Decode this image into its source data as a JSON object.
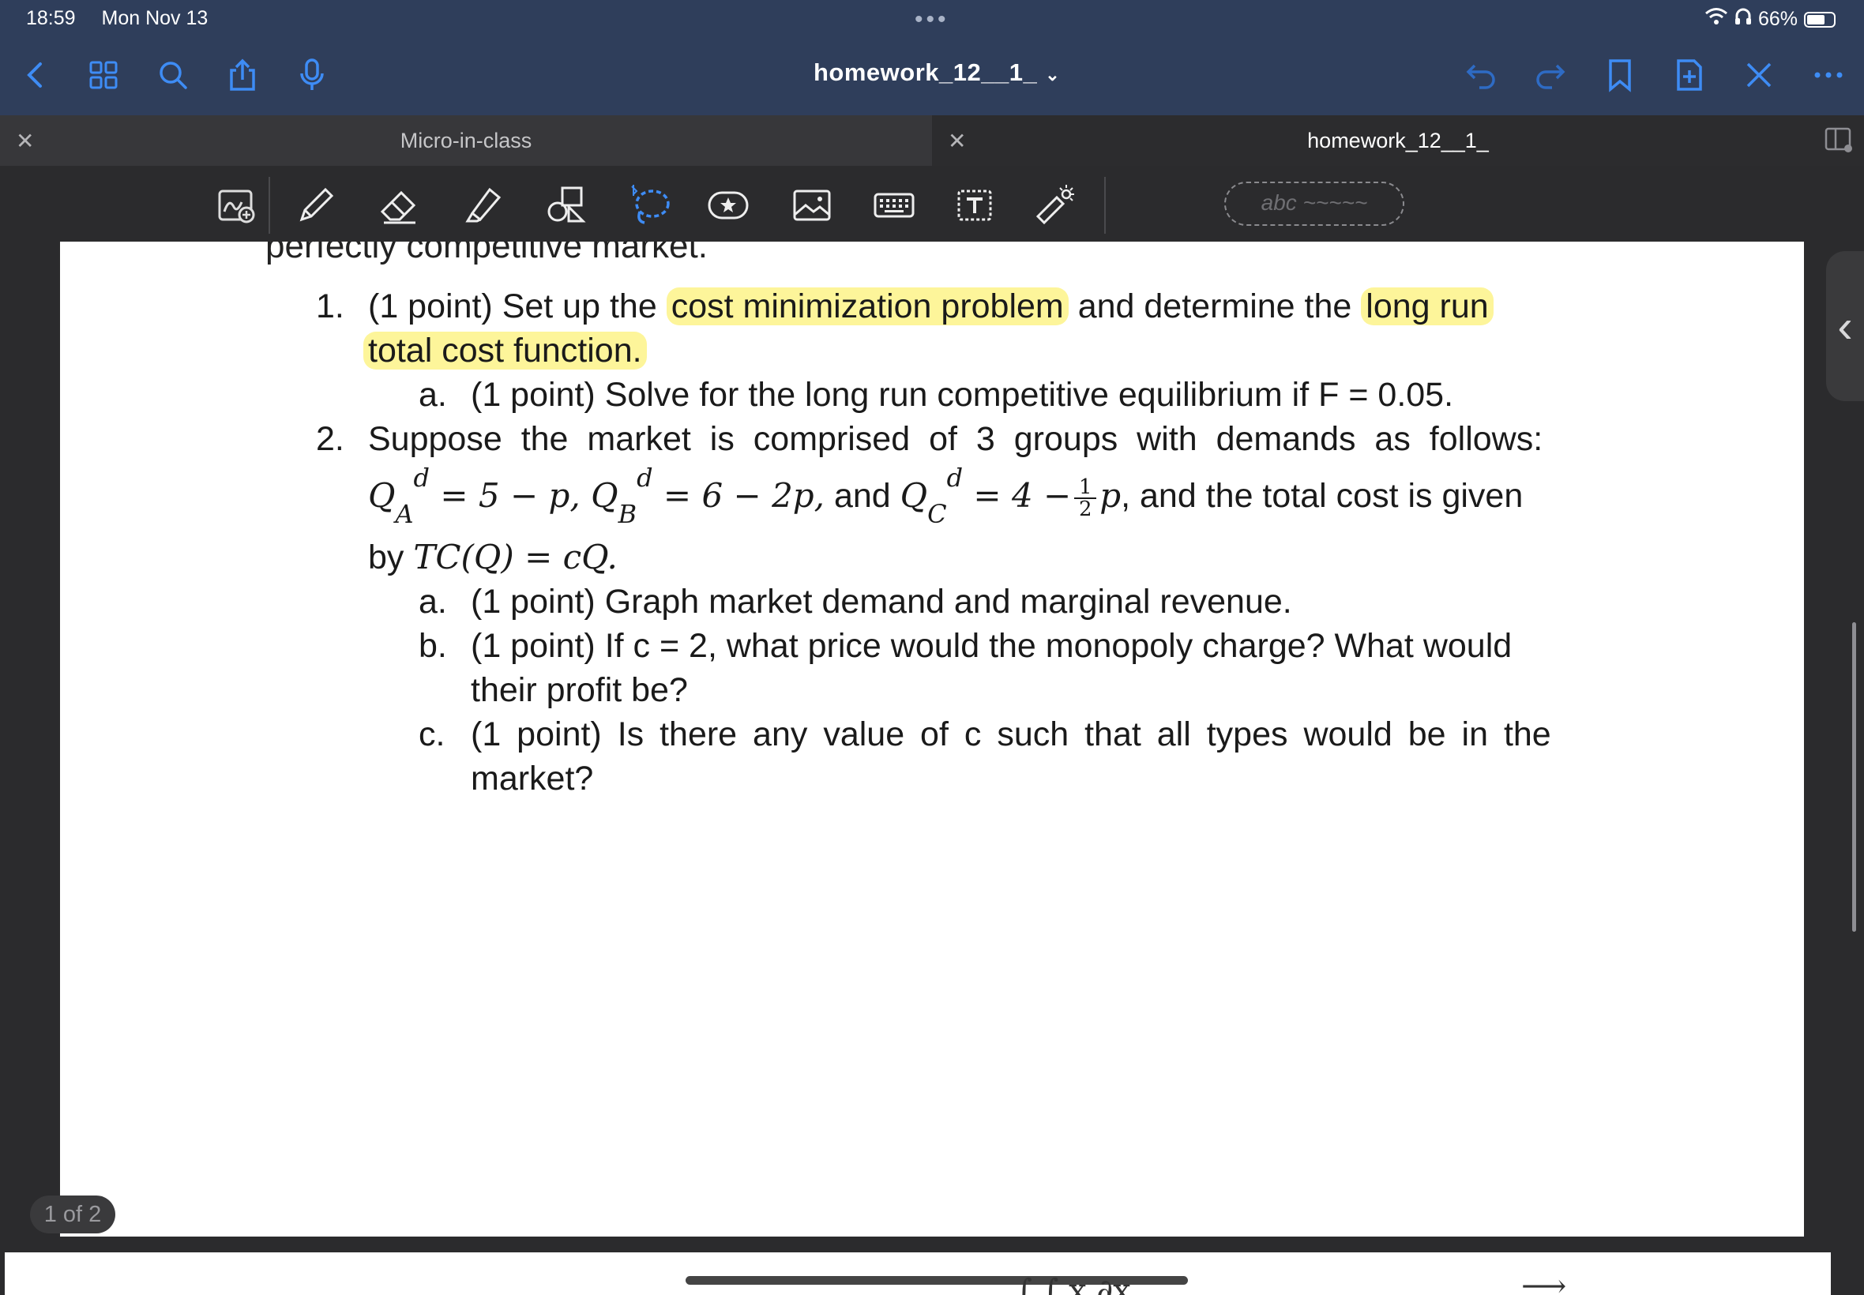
{
  "status_bar": {
    "time": "18:59",
    "date": "Mon Nov 13",
    "battery": "66%"
  },
  "top_bar": {
    "title": "homework_12__1_"
  },
  "tabs": [
    {
      "label": "Micro-in-class"
    },
    {
      "label": "homework_12__1_"
    }
  ],
  "toolbar": {
    "text_field_placeholder": "abc"
  },
  "page": {
    "items": {
      "q1_num": "1.",
      "q1_pre": "(1 point) Set up the ",
      "q1_hl1": "cost minimization problem",
      "q1_mid": " and determine the ",
      "q1_hl2a": "long run",
      "q1_hl2b": "total cost function.",
      "q1a_letter": "a.",
      "q1a_text": "(1 point) Solve for the long run competitive equilibrium if F = 0.05.",
      "q2_num": "2.",
      "q2_text": "Suppose the market is comprised of 3 groups with demands as follows:",
      "q2_and": " and ",
      "q2_tail": ", and the total cost is given",
      "q2_by": "by ",
      "q2a_letter": "a.",
      "q2a_text": "(1 point) Graph market demand and marginal revenue.",
      "q2b_letter": "b.",
      "q2b_text1": "(1 point) If c = 2, what price would the monopoly charge? What would",
      "q2b_text2": "their profit be?",
      "q2c_letter": "c.",
      "q2c_text1": "(1 point) Is there any value of c such that all types would be in the",
      "q2c_text2": "market?"
    }
  },
  "page_indicator": "1 of 2"
}
